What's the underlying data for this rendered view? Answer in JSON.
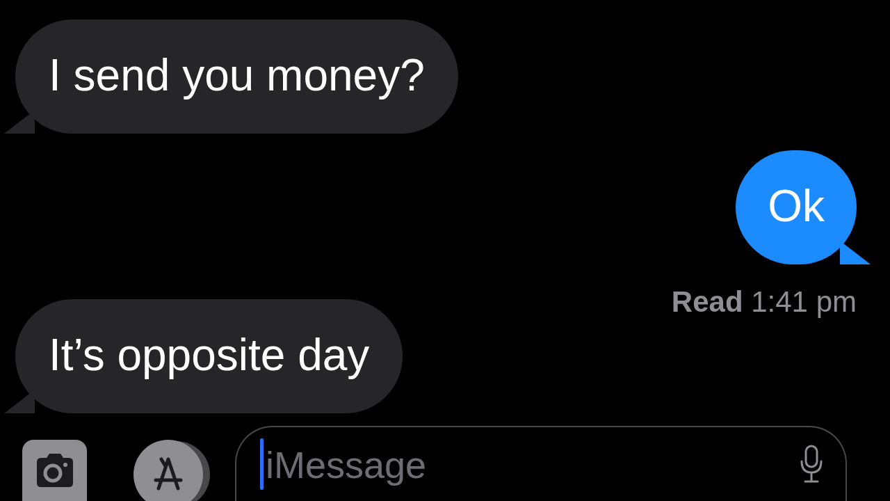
{
  "messages": [
    {
      "kind": "received",
      "text": "I send you money?"
    },
    {
      "kind": "sent",
      "text": "Ok"
    },
    {
      "kind": "receipt",
      "label": "Read",
      "time": "1:41 pm"
    },
    {
      "kind": "received",
      "text": "It’s opposite day"
    }
  ],
  "composer": {
    "placeholder": "iMessage"
  }
}
